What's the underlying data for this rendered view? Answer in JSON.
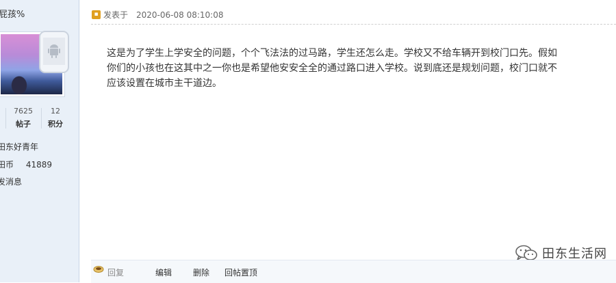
{
  "user": {
    "username": "屁孩%",
    "stats": [
      {
        "value": "7625",
        "label": "帖子"
      },
      {
        "value": "12",
        "label": "积分"
      }
    ],
    "group": "田东好青年",
    "coins_label": "田币",
    "coins_value": "41889",
    "send_message": "发消息"
  },
  "post": {
    "posted_label": "发表于",
    "timestamp": "2020-06-08 08:10:08",
    "body_lines": [
      "这是为了学生上学安全的问题，个个飞法法的过马路，学生还怎么走。学校又不给车辆开到校门口先。假如",
      "你们的小孩也在这其中之一你也是希望他安安全全的通过路口进入学校。说到底还是规划问题，校门口就不",
      "应该设置在城市主干道边。"
    ]
  },
  "watermark": {
    "text": "田东生活网"
  },
  "actions": {
    "reply": "回复",
    "edit": "编辑",
    "delete": "删除",
    "bump": "回帖置顶"
  },
  "colors": {
    "sidebar_bg": "#e9f0f8",
    "footer_bg": "#f5f8fb",
    "accent_icon": "#e0a020"
  }
}
